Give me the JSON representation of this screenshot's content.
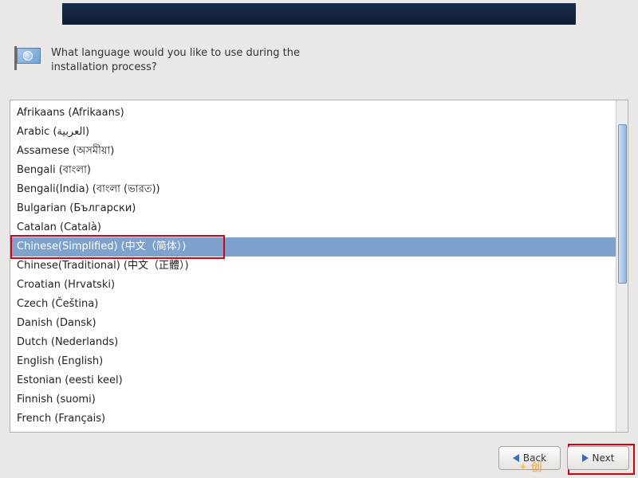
{
  "header": {
    "banner_color_start": "#1a2d4d",
    "banner_color_end": "#0f1d36"
  },
  "prompt": {
    "line1": "What language would you like to use during the",
    "line2": "installation process?"
  },
  "languages": [
    {
      "label": "Afrikaans (Afrikaans)",
      "selected": false
    },
    {
      "label": "Arabic (العربية)",
      "selected": false
    },
    {
      "label": "Assamese (অসমীয়া)",
      "selected": false
    },
    {
      "label": "Bengali (বাংলা)",
      "selected": false
    },
    {
      "label": "Bengali(India) (বাংলা (ভারত))",
      "selected": false
    },
    {
      "label": "Bulgarian (Български)",
      "selected": false
    },
    {
      "label": "Catalan (Català)",
      "selected": false
    },
    {
      "label": "Chinese(Simplified) (中文（简体）)",
      "selected": true
    },
    {
      "label": "Chinese(Traditional) (中文（正體）)",
      "selected": false
    },
    {
      "label": "Croatian (Hrvatski)",
      "selected": false
    },
    {
      "label": "Czech (Čeština)",
      "selected": false
    },
    {
      "label": "Danish (Dansk)",
      "selected": false
    },
    {
      "label": "Dutch (Nederlands)",
      "selected": false
    },
    {
      "label": "English (English)",
      "selected": false
    },
    {
      "label": "Estonian (eesti keel)",
      "selected": false
    },
    {
      "label": "Finnish (suomi)",
      "selected": false
    },
    {
      "label": "French (Français)",
      "selected": false
    }
  ],
  "buttons": {
    "back_label": "Back",
    "next_label": "Next"
  },
  "highlights": {
    "language_box": true,
    "next_box": true
  },
  "watermark": "创"
}
